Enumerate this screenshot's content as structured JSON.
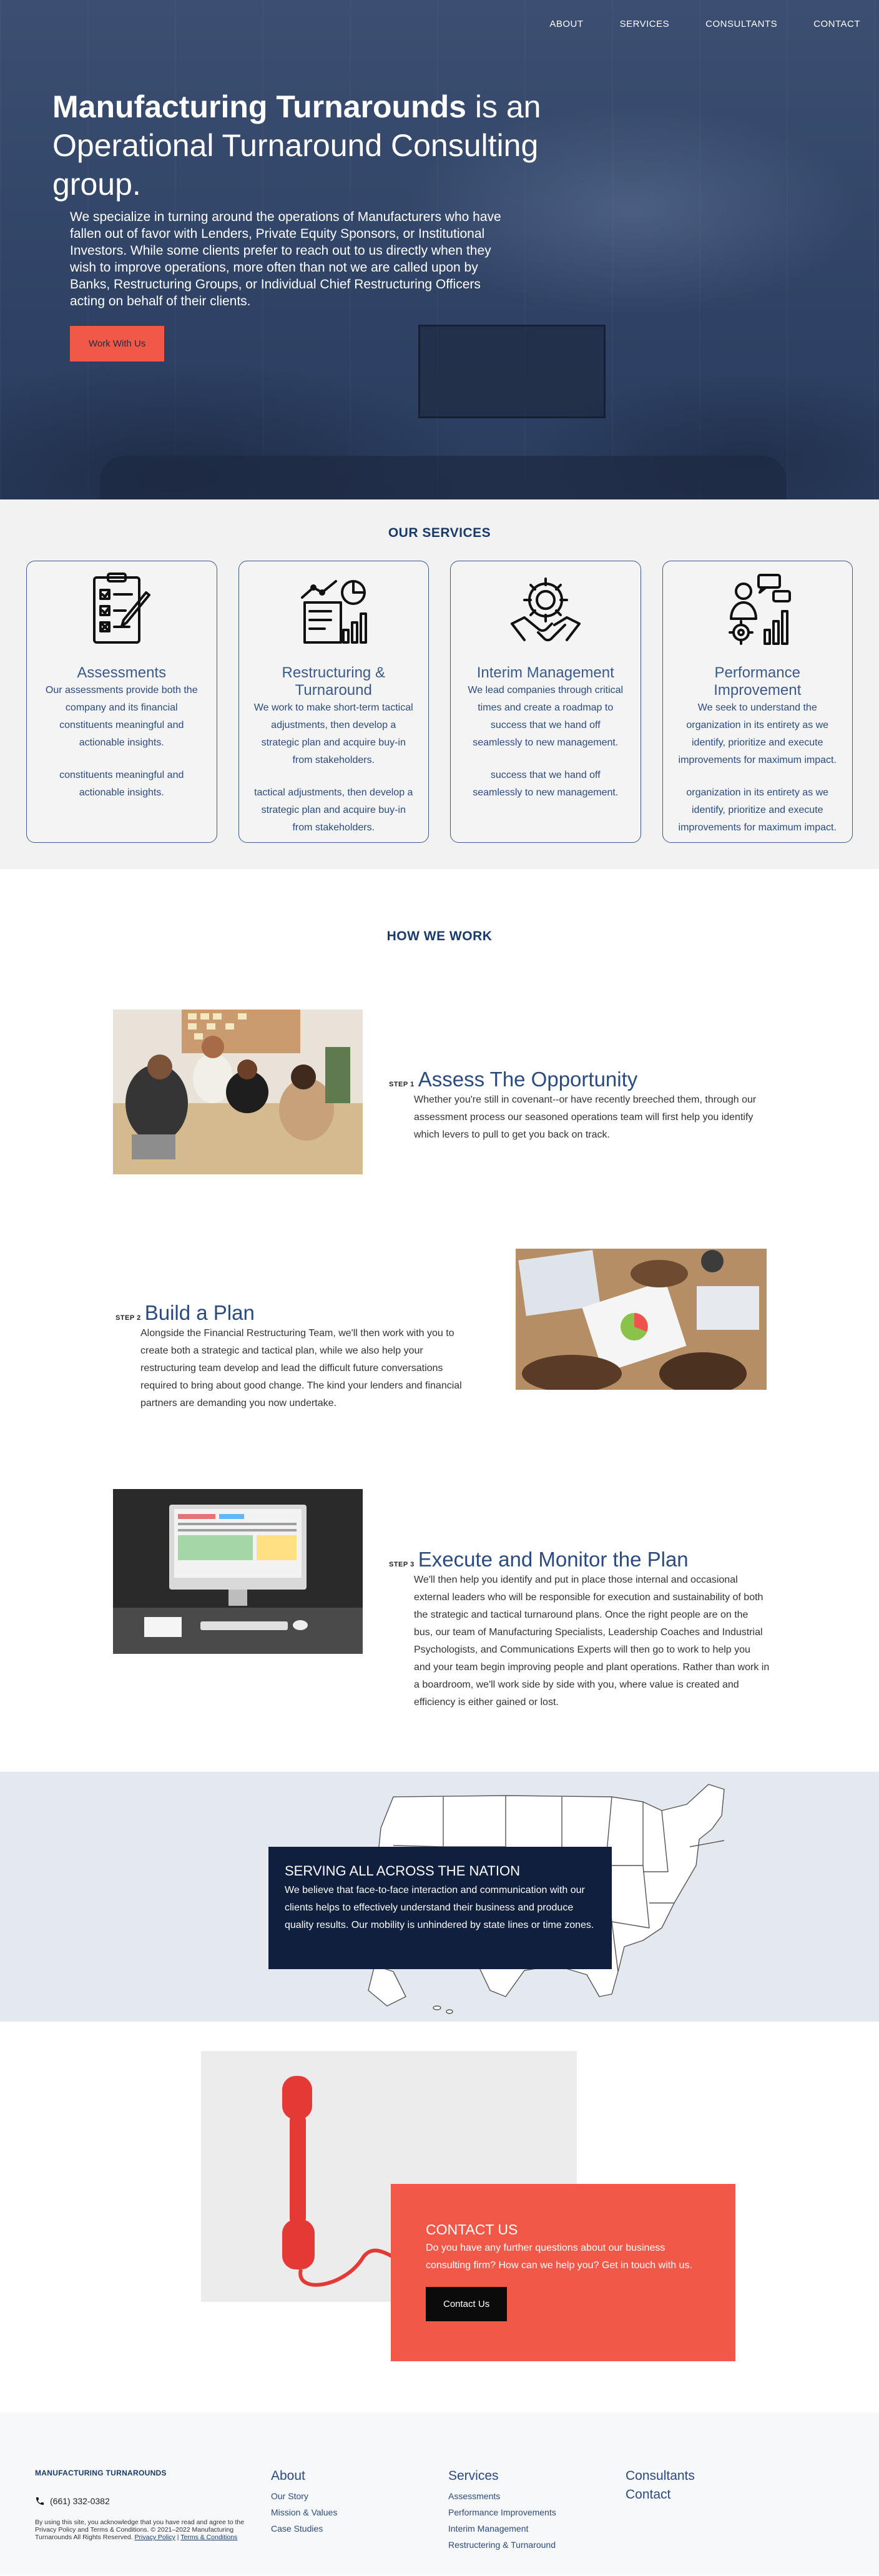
{
  "nav": {
    "items": [
      "ABOUT",
      "SERVICES",
      "CONSULTANTS",
      "CONTACT"
    ]
  },
  "hero": {
    "title_bold": "Manufacturing Turnarounds",
    "title_rest": " is an",
    "title_line2": "Operational Turnaround Consulting group.",
    "body": "We specialize in turning around the operations of Manufacturers who have fallen out of favor with Lenders, Private Equity Sponsors, or Institutional Investors. While some clients prefer to reach out to us directly when they wish to improve operations, more often than not we are called upon by Banks, Restructuring Groups, or Individual Chief Restructuring Officers acting on behalf of their clients.",
    "cta": "Work With Us"
  },
  "services": {
    "title": "OUR SERVICES",
    "cards": [
      {
        "icon": "checklist-icon",
        "title": "Assessments",
        "p1": "Our assessments provide both the company and its financial constituents meaningful and actionable insights.",
        "p2": "constituents meaningful and actionable insights."
      },
      {
        "icon": "chart-report-icon",
        "title": "Restructuring & Turnaround",
        "p1": "We work to make short-term tactical adjustments, then develop a strategic plan and acquire buy-in from stakeholders.",
        "p2": "tactical adjustments, then develop a strategic plan and acquire buy-in from stakeholders."
      },
      {
        "icon": "gear-handshake-icon",
        "title": "Interim Management",
        "p1": "We lead companies through critical times and create a roadmap to success that we hand off seamlessly to new management.",
        "p2": "success that we hand off seamlessly to new management."
      },
      {
        "icon": "team-performance-icon",
        "title": "Performance Improvement",
        "p1": "We seek to understand the organization in its entirety as we identify, prioritize and execute improvements for maximum impact.",
        "p2": "organization in its entirety as we identify, prioritize and execute improvements for maximum impact."
      }
    ]
  },
  "how": {
    "title": "HOW WE WORK",
    "steps": [
      {
        "label": "STEP 1",
        "title": "Assess The Opportunity",
        "body": "Whether you're still in covenant--or have recently breeched them, through our assessment process our seasoned operations team will first help you identify which levers to pull to get you back on track."
      },
      {
        "label": "STEP 2",
        "title": "Build a Plan",
        "body": "Alongside the Financial Restructuring Team, we'll then work with you to create both a strategic and tactical plan, while we also help your restructuring team develop and lead the difficult future conversations required to bring about good change. The kind your lenders and financial partners are demanding you now undertake."
      },
      {
        "label": "STEP 3",
        "title": "Execute and Monitor the Plan",
        "body": "We'll then help you identify and put in place those internal and occasional external leaders who will be responsible for execution and sustainability of both the strategic and tactical turnaround plans. Once the right people are on the bus, our team of Manufacturing Specialists, Leadership Coaches and Industrial Psychologists, and Communications Experts will then go to work to help you and your team begin improving people and plant operations. Rather than work in a boardroom, we'll work side by side with you, where value is created and efficiency is either gained or lost."
      }
    ]
  },
  "nation": {
    "title": "SERVING ALL ACROSS THE NATION",
    "body": "We believe that face-to-face interaction and communication with our clients helps to effectively understand their business and produce quality results. Our mobility is unhindered by state lines or time zones."
  },
  "contact": {
    "title": "CONTACT US",
    "body": "Do you have any further questions about our business consulting firm? How can we help you? Get in touch with us.",
    "cta": "Contact Us"
  },
  "footer": {
    "brand": "MANUFACTURING TURNAROUNDS",
    "phone": "(661) 332-0382",
    "legal_text": "By using this site, you acknowledge that you have read and agree to the Privacy Policy and Terms & Conditions. © 2021–2022 Manufacturing Turnarounds All Rights Reserved.",
    "privacy_link": "Privacy Policy",
    "separator": " | ",
    "terms_link": "Terms & Conditions",
    "about": {
      "title": "About",
      "links": [
        "Our Story",
        "Mission & Values",
        "Case Studies"
      ]
    },
    "services": {
      "title": "Services",
      "links": [
        "Assessments",
        "Performance Improvements",
        "Interim Management",
        "Restructering & Turnaround"
      ]
    },
    "consultants": {
      "title": "Consultants"
    },
    "contact": {
      "title": "Contact"
    }
  },
  "colors": {
    "navy": "#1a3a6b",
    "accent_red": "#f25847",
    "dark_box": "#0f1f3d",
    "hero_bg": "#34486b"
  }
}
